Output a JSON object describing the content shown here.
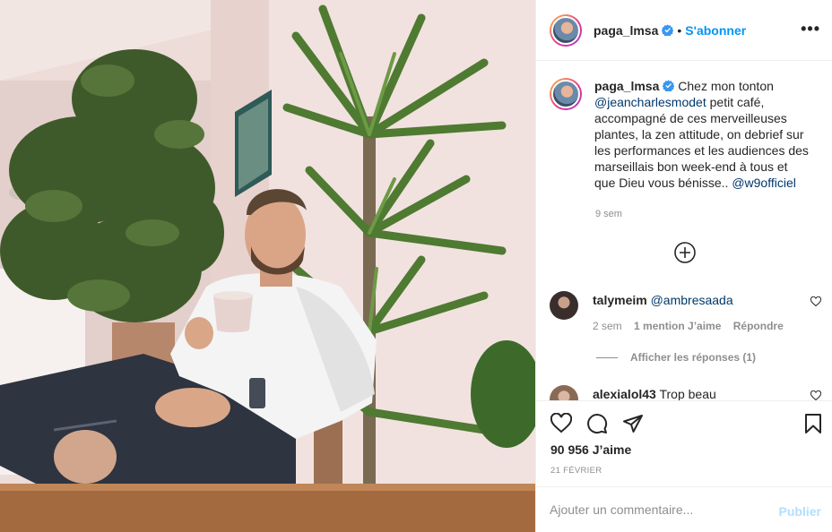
{
  "post": {
    "username": "paga_lmsa",
    "follow_label": "S'abonner",
    "more_label": "•••",
    "caption_text_1": " Chez mon tonton ",
    "caption_mention_1": "@jeancharlesmodet",
    "caption_text_2": " petit café, accompagné de ces merveilleuses plantes, la zen attitude, on debrief sur les performances et les audiences des marseillais bon week-end à tous et que Dieu vous bénisse.. ",
    "caption_mention_2": "@w9officiel",
    "caption_time": "9 sem",
    "likes": "90 956 J’aime",
    "date": "21 FÉVRIER"
  },
  "comments": [
    {
      "username": "talymeim",
      "text": "@ambresaada",
      "time": "2 sem",
      "likes": "1 mention J’aime",
      "reply": "Répondre",
      "view_replies": "Afficher les réponses (1)"
    },
    {
      "username": "alexialol43",
      "text": "Trop beau"
    }
  ],
  "add_comment": {
    "placeholder": "Ajouter un commentaire...",
    "publish_label": "Publier"
  },
  "colors": {
    "accent": "#0095f6",
    "publish_disabled": "#b2dffc",
    "mention": "#00376b",
    "muted": "#8e8e8e"
  },
  "icons": [
    "verified-icon",
    "more-options-icon",
    "load-more-icon",
    "heart-icon",
    "comment-icon",
    "share-icon",
    "bookmark-icon"
  ]
}
